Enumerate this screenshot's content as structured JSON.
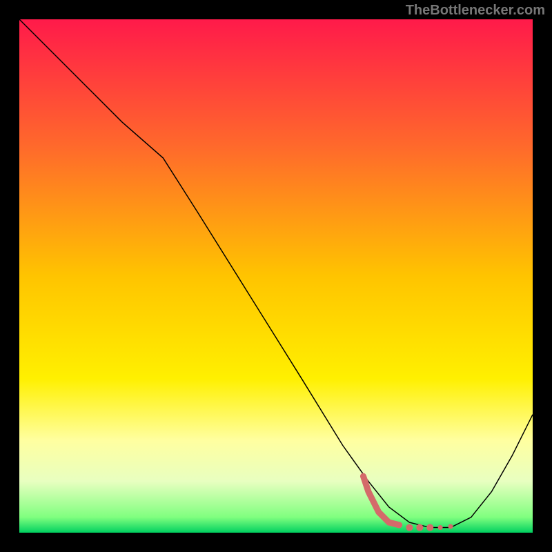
{
  "watermark": "TheBottlenecker.com",
  "chart_data": {
    "type": "line",
    "title": "",
    "xlabel": "",
    "ylabel": "",
    "xlim": [
      0,
      100
    ],
    "ylim": [
      0,
      100
    ],
    "grid": false,
    "legend": false,
    "background_gradient": {
      "stops": [
        {
          "offset": 0,
          "color": "#ff1a4a"
        },
        {
          "offset": 25,
          "color": "#ff6a2b"
        },
        {
          "offset": 50,
          "color": "#ffc400"
        },
        {
          "offset": 70,
          "color": "#fff000"
        },
        {
          "offset": 82,
          "color": "#ffffa0"
        },
        {
          "offset": 90,
          "color": "#e8ffc0"
        },
        {
          "offset": 97,
          "color": "#7fff7f"
        },
        {
          "offset": 100,
          "color": "#00d060"
        }
      ]
    },
    "series": [
      {
        "name": "bottleneck-curve",
        "color": "#000000",
        "width": 1.5,
        "x": [
          0,
          10,
          20,
          28,
          35,
          45,
          55,
          63,
          68,
          72,
          76,
          80,
          84,
          88,
          92,
          96,
          100
        ],
        "y": [
          100,
          90,
          80,
          73,
          62,
          46,
          30,
          17,
          10,
          5,
          2,
          1,
          1,
          3,
          8,
          15,
          23
        ]
      },
      {
        "name": "optimal-zone",
        "color": "#d46a6a",
        "width": 9,
        "type": "scatter-line",
        "x": [
          67,
          68,
          69,
          70,
          72,
          74,
          76,
          78,
          80,
          82,
          84
        ],
        "y": [
          11,
          8,
          6,
          4,
          2,
          1.5,
          1,
          1,
          1,
          1,
          1.2
        ]
      }
    ]
  }
}
